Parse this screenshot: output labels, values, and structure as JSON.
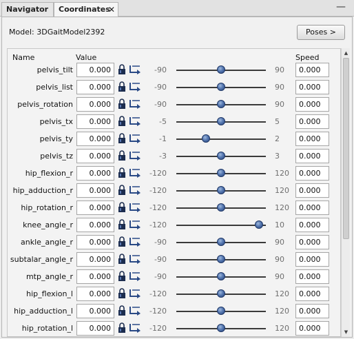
{
  "tabs": {
    "navigator": "Navigator",
    "coordinates": "Coordinates",
    "close_glyph": "✕",
    "minimize_glyph": "—"
  },
  "model": {
    "label": "Model:  3DGaitModel2392"
  },
  "poses_button": "Poses >",
  "headers": {
    "name": "Name",
    "value": "Value",
    "speed": "Speed"
  },
  "icons": {
    "lock": "lock-icon",
    "arrow": "bent-arrow-icon"
  },
  "colors": {
    "knob": "#4a6aa5",
    "track": "#3a3a3a"
  },
  "coordinates": [
    {
      "name": "pelvis_tilt",
      "value": "0.000",
      "min": "-90",
      "max": "90",
      "slider": 0.5,
      "speed": "0.000"
    },
    {
      "name": "pelvis_list",
      "value": "0.000",
      "min": "-90",
      "max": "90",
      "slider": 0.5,
      "speed": "0.000"
    },
    {
      "name": "pelvis_rotation",
      "value": "0.000",
      "min": "-90",
      "max": "90",
      "slider": 0.5,
      "speed": "0.000"
    },
    {
      "name": "pelvis_tx",
      "value": "0.000",
      "min": "-5",
      "max": "5",
      "slider": 0.5,
      "speed": "0.000"
    },
    {
      "name": "pelvis_ty",
      "value": "0.000",
      "min": "-1",
      "max": "2",
      "slider": 0.333,
      "speed": "0.000"
    },
    {
      "name": "pelvis_tz",
      "value": "0.000",
      "min": "-3",
      "max": "3",
      "slider": 0.5,
      "speed": "0.000"
    },
    {
      "name": "hip_flexion_r",
      "value": "0.000",
      "min": "-120",
      "max": "120",
      "slider": 0.5,
      "speed": "0.000"
    },
    {
      "name": "hip_adduction_r",
      "value": "0.000",
      "min": "-120",
      "max": "120",
      "slider": 0.5,
      "speed": "0.000"
    },
    {
      "name": "hip_rotation_r",
      "value": "0.000",
      "min": "-120",
      "max": "120",
      "slider": 0.5,
      "speed": "0.000"
    },
    {
      "name": "knee_angle_r",
      "value": "0.000",
      "min": "-120",
      "max": "10",
      "slider": 0.923,
      "speed": "0.000"
    },
    {
      "name": "ankle_angle_r",
      "value": "0.000",
      "min": "-90",
      "max": "90",
      "slider": 0.5,
      "speed": "0.000"
    },
    {
      "name": "subtalar_angle_r",
      "value": "0.000",
      "min": "-90",
      "max": "90",
      "slider": 0.5,
      "speed": "0.000"
    },
    {
      "name": "mtp_angle_r",
      "value": "0.000",
      "min": "-90",
      "max": "90",
      "slider": 0.5,
      "speed": "0.000"
    },
    {
      "name": "hip_flexion_l",
      "value": "0.000",
      "min": "-120",
      "max": "120",
      "slider": 0.5,
      "speed": "0.000"
    },
    {
      "name": "hip_adduction_l",
      "value": "0.000",
      "min": "-120",
      "max": "120",
      "slider": 0.5,
      "speed": "0.000"
    },
    {
      "name": "hip_rotation_l",
      "value": "0.000",
      "min": "-120",
      "max": "120",
      "slider": 0.5,
      "speed": "0.000"
    }
  ]
}
